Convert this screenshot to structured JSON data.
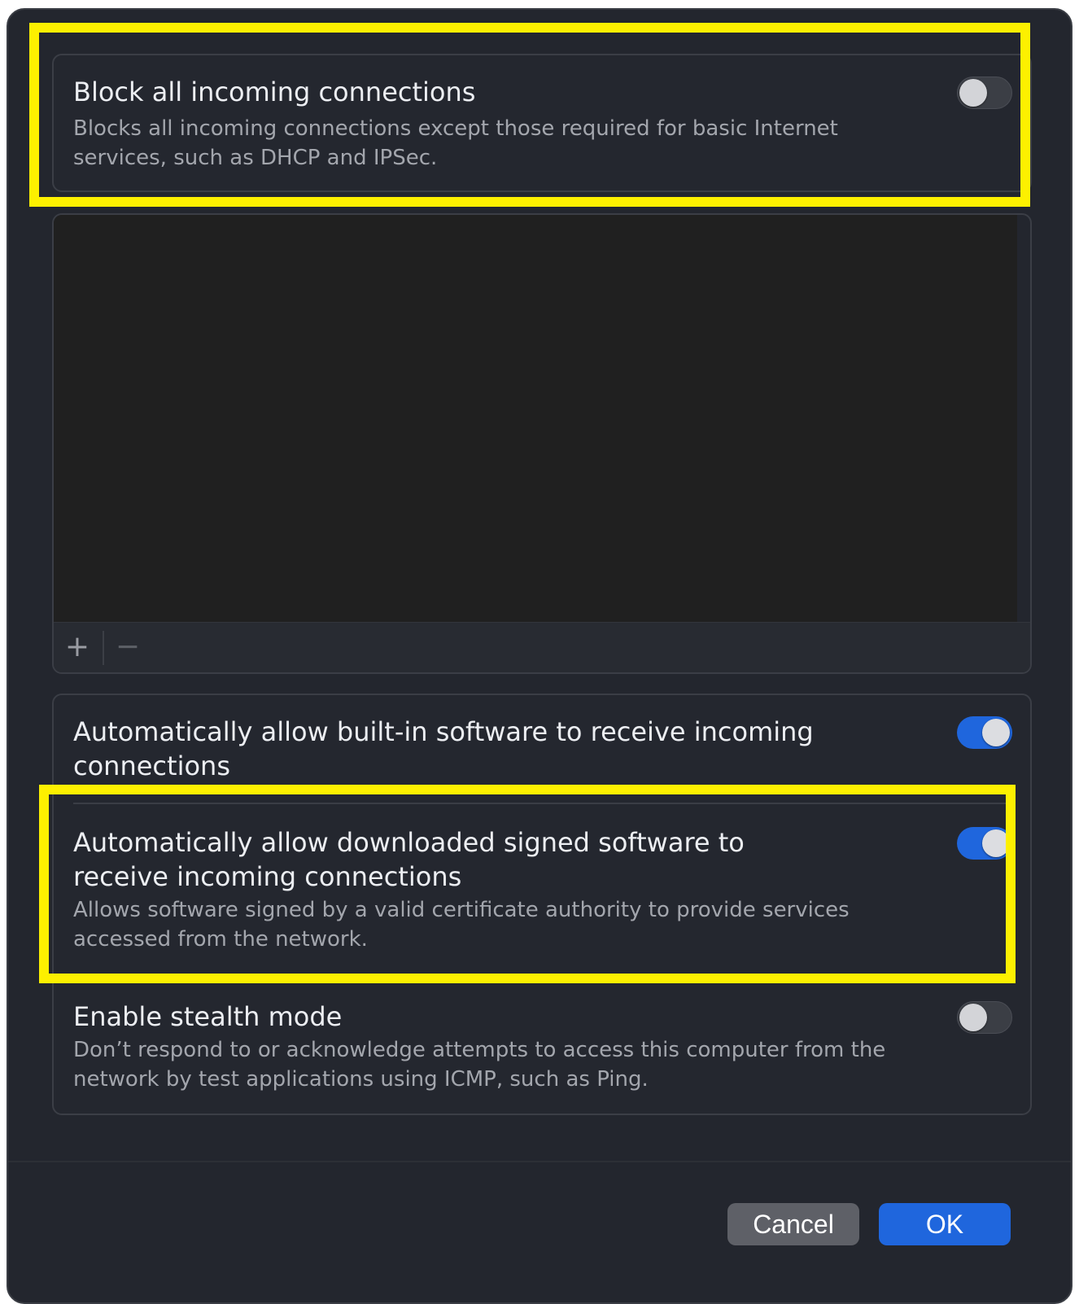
{
  "block_all": {
    "title": "Block all incoming connections",
    "description": "Blocks all incoming connections except those required for basic Internet services, such as DHCP and IPSec.",
    "enabled": false
  },
  "app_list": {
    "add_label": "+",
    "remove_label": "−"
  },
  "options": {
    "builtin": {
      "title": "Automatically allow built-in software to receive incoming connections",
      "enabled": true
    },
    "signed": {
      "title": "Automatically allow downloaded signed software to receive incoming connections",
      "description": "Allows software signed by a valid certificate authority to provide services accessed from the network.",
      "enabled": true
    },
    "stealth": {
      "title": "Enable stealth mode",
      "description": "Don’t respond to or acknowledge attempts to access this computer from the network by test applications using ICMP, such as Ping.",
      "enabled": false
    }
  },
  "footer": {
    "cancel_label": "Cancel",
    "ok_label": "OK"
  },
  "colors": {
    "accent": "#1f66dd",
    "highlight": "#fdf000",
    "background": "#23262e"
  }
}
